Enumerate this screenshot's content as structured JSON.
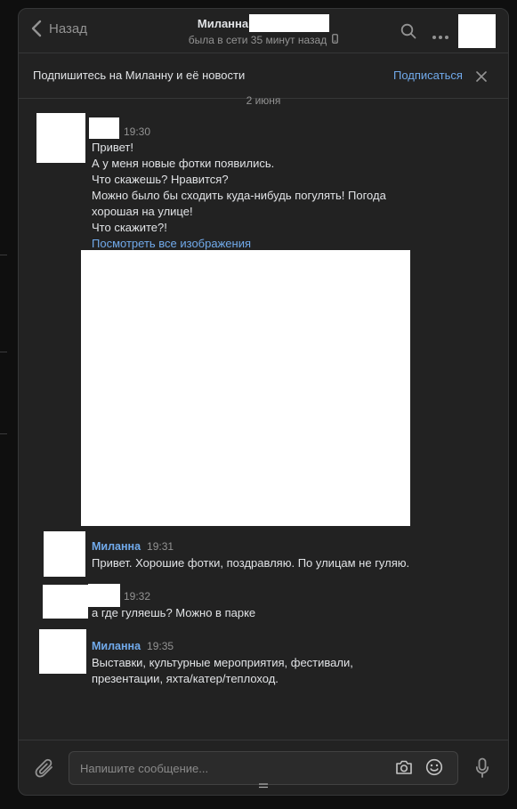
{
  "header": {
    "back_label": "Назад",
    "contact_name": "Миланна",
    "status": "была в сети 35 минут назад"
  },
  "subscribe_bar": {
    "text": "Подпишитесь на Миланну и её новости",
    "button": "Подписаться"
  },
  "date_separator": "2 июня",
  "messages": [
    {
      "author": "",
      "time": "19:30",
      "lines": [
        "Привет!",
        "А у меня новые фотки появились.",
        "Что скажешь? Нравится?",
        "Можно было бы сходить куда-нибудь погулять! Погода",
        "хорошая на улице!",
        "Что скажите?!"
      ],
      "link": "Посмотреть все изображения"
    },
    {
      "author": "Миланна",
      "time": "19:31",
      "lines": [
        "Привет. Хорошие фотки, поздравляю. По улицам не гуляю."
      ]
    },
    {
      "author": "",
      "time": "19:32",
      "lines": [
        "а где гуляешь? Можно в парке"
      ]
    },
    {
      "author": "Миланна",
      "time": "19:35",
      "lines": [
        "Выставки, культурные мероприятия, фестивали,",
        "презентации, яхта/катер/теплоход."
      ]
    }
  ],
  "composer": {
    "placeholder": "Напишите сообщение..."
  },
  "icons": {
    "back": "chevron-left-icon",
    "phone": "phone-icon",
    "search": "search-icon",
    "more": "more-horizontal-icon",
    "close": "close-icon",
    "attach": "paperclip-icon",
    "camera": "camera-icon",
    "emoji": "smile-icon",
    "microphone": "microphone-icon"
  },
  "colors": {
    "accent": "#71aaeb",
    "background": "#222222",
    "text": "#e1e3e6",
    "muted": "#939393"
  }
}
